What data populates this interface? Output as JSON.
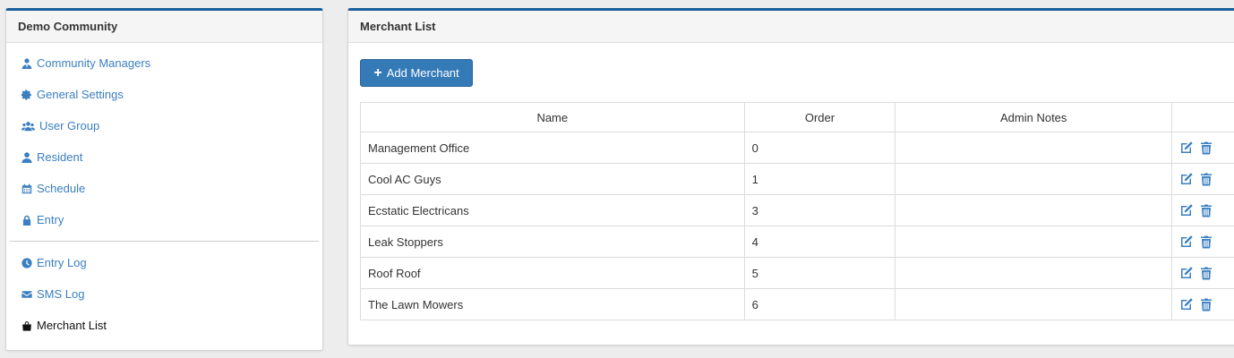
{
  "sidebar": {
    "title": "Demo Community",
    "items": [
      {
        "label": "Community Managers",
        "icon": "user-tie-icon"
      },
      {
        "label": "General Settings",
        "icon": "gear-icon"
      },
      {
        "label": "User Group",
        "icon": "users-icon"
      },
      {
        "label": "Resident",
        "icon": "user-icon"
      },
      {
        "label": "Schedule",
        "icon": "calendar-icon"
      },
      {
        "label": "Entry",
        "icon": "lock-icon"
      }
    ],
    "items2": [
      {
        "label": "Entry Log",
        "icon": "clock-icon"
      },
      {
        "label": "SMS Log",
        "icon": "envelope-icon"
      },
      {
        "label": "Merchant List",
        "icon": "shopping-bag-icon",
        "active": true
      }
    ]
  },
  "main": {
    "title": "Merchant List",
    "add_button": "Add Merchant",
    "columns": [
      "Name",
      "Order",
      "Admin Notes",
      ""
    ],
    "rows": [
      {
        "name": "Management Office",
        "order": "0",
        "notes": ""
      },
      {
        "name": "Cool AC Guys",
        "order": "1",
        "notes": ""
      },
      {
        "name": "Ecstatic Electricans",
        "order": "3",
        "notes": ""
      },
      {
        "name": "Leak Stoppers",
        "order": "4",
        "notes": ""
      },
      {
        "name": "Roof Roof",
        "order": "5",
        "notes": ""
      },
      {
        "name": "The Lawn Mowers",
        "order": "6",
        "notes": ""
      }
    ]
  },
  "colors": {
    "accent": "#1a5f9c",
    "link": "#3a7fc1",
    "button": "#337ab7"
  }
}
